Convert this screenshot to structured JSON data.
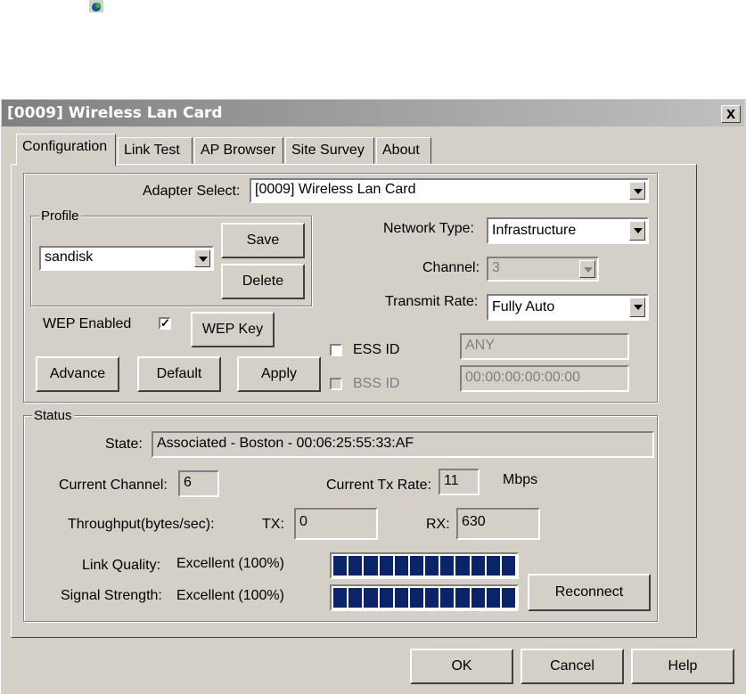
{
  "window": {
    "title": "[0009] Wireless Lan Card",
    "close_label": "x"
  },
  "tabs": [
    {
      "label": "Configuration",
      "active": true
    },
    {
      "label": "Link Test"
    },
    {
      "label": "AP Browser"
    },
    {
      "label": "Site Survey"
    },
    {
      "label": "About"
    }
  ],
  "config": {
    "adapter_select_label": "Adapter Select:",
    "adapter_select_value": "[0009] Wireless Lan Card",
    "profile_legend": "Profile",
    "profile_value": "sandisk",
    "save_label": "Save",
    "delete_label": "Delete",
    "network_type_label": "Network Type:",
    "network_type_value": "Infrastructure",
    "channel_label": "Channel:",
    "channel_value": "3",
    "transmit_rate_label": "Transmit Rate:",
    "transmit_rate_value": "Fully Auto",
    "wep_enabled_label": "WEP Enabled",
    "wep_enabled_checked": "✓",
    "wep_key_label": "WEP Key",
    "ess_id_label": "ESS ID",
    "ess_id_value": "ANY",
    "bss_id_label": "BSS ID",
    "bss_id_value": "00:00:00:00:00:00",
    "advance_label": "Advance",
    "default_label": "Default",
    "apply_label": "Apply"
  },
  "status": {
    "legend": "Status",
    "state_label": "State:",
    "state_value": "Associated - Boston - 00:06:25:55:33:AF",
    "current_channel_label": "Current Channel:",
    "current_channel_value": "6",
    "current_tx_rate_label": "Current Tx Rate:",
    "current_tx_rate_value": "11",
    "mbps_label": "Mbps",
    "throughput_label": "Throughput(bytes/sec):",
    "tx_label": "TX:",
    "tx_value": "0",
    "rx_label": "RX:",
    "rx_value": "630",
    "link_quality_label": "Link Quality:",
    "link_quality_value": "Excellent (100%)",
    "link_quality_fraction": 1.0,
    "signal_strength_label": "Signal Strength:",
    "signal_strength_value": "Excellent (100%)",
    "signal_strength_fraction": 1.0,
    "reconnect_label": "Reconnect"
  },
  "footer": {
    "ok_label": "OK",
    "cancel_label": "Cancel",
    "help_label": "Help"
  },
  "colors": {
    "face": "#d4d0c8",
    "meter_fill": "#0a246a",
    "title_gradient_start": "#808080"
  }
}
